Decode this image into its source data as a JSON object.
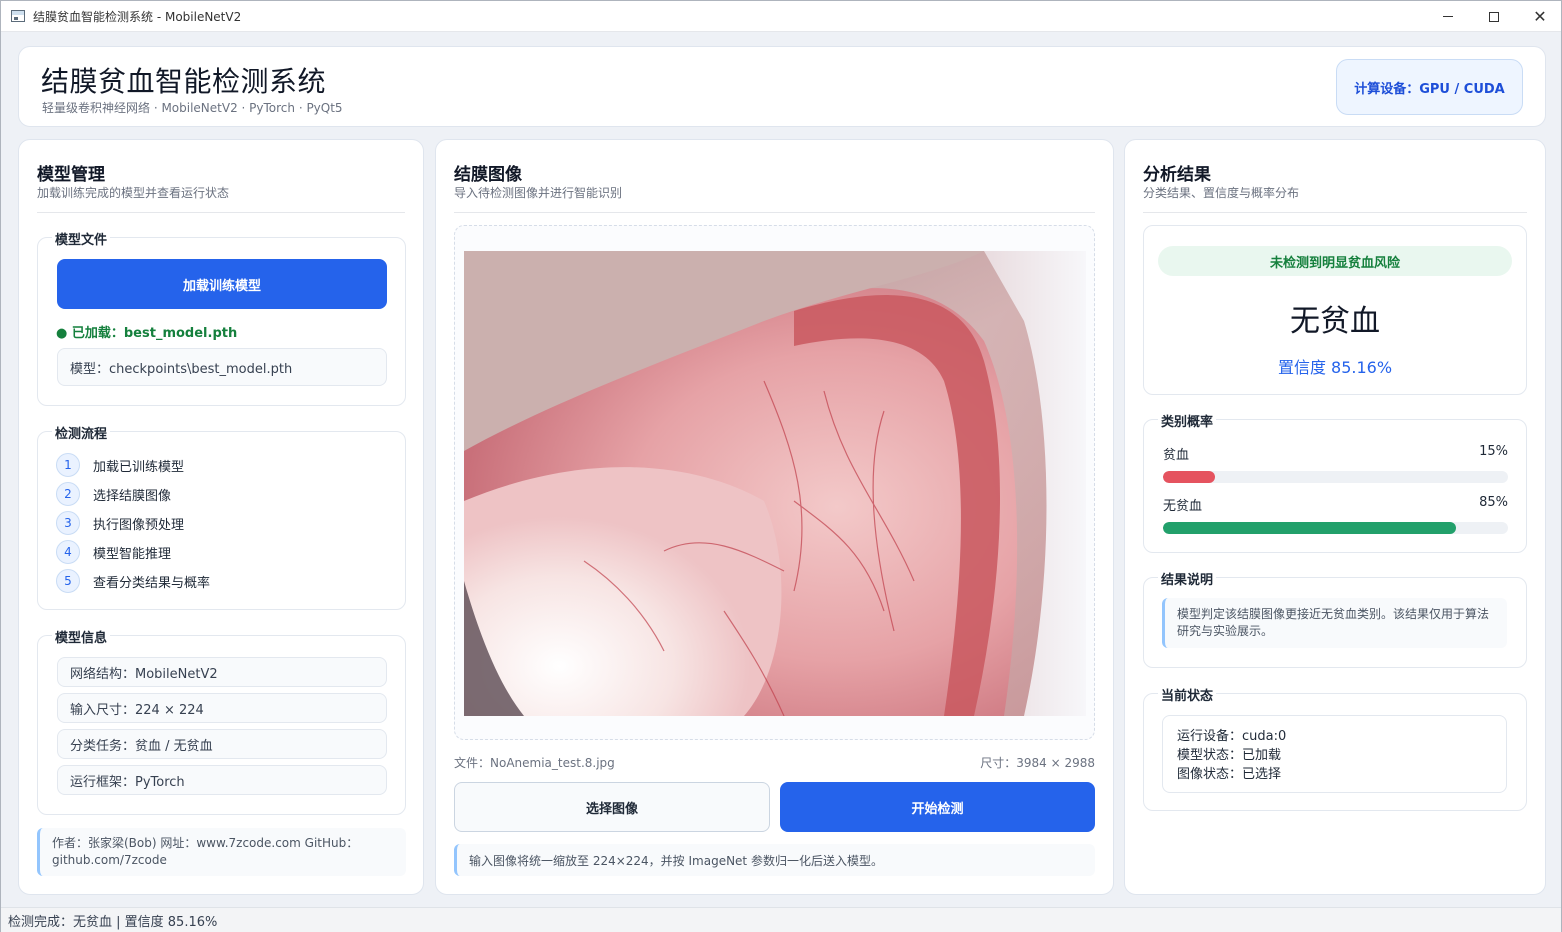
{
  "window": {
    "title": "结膜贫血智能检测系统 - MobileNetV2"
  },
  "header": {
    "title": "结膜贫血智能检测系统",
    "subtitle": "轻量级卷积神经网络 · MobileNetV2 · PyTorch · PyQt5",
    "device_badge": "计算设备：GPU / CUDA"
  },
  "left_panel": {
    "title": "模型管理",
    "subtitle": "加载训练完成的模型并查看运行状态",
    "model_file": {
      "label": "模型文件",
      "load_button": "加载训练模型",
      "loaded_status": "● 已加载：best_model.pth",
      "model_path": "模型：checkpoints\\best_model.pth"
    },
    "workflow": {
      "label": "检测流程",
      "steps": [
        {
          "num": "1",
          "text": "加载已训练模型"
        },
        {
          "num": "2",
          "text": "选择结膜图像"
        },
        {
          "num": "3",
          "text": "执行图像预处理"
        },
        {
          "num": "4",
          "text": "模型智能推理"
        },
        {
          "num": "5",
          "text": "查看分类结果与概率"
        }
      ]
    },
    "model_info": {
      "label": "模型信息",
      "items": [
        "网络结构：MobileNetV2",
        "输入尺寸：224 × 224",
        "分类任务：贫血 / 无贫血",
        "运行框架：PyTorch"
      ]
    },
    "author_note": "作者：张家梁(Bob)  网址：www.7zcode.com GitHub：github.com/7zcode"
  },
  "mid_panel": {
    "title": "结膜图像",
    "subtitle": "导入待检测图像并进行智能识别",
    "file_label": "文件：NoAnemia_test.8.jpg",
    "size_label": "尺寸：3984 × 2988",
    "select_button": "选择图像",
    "detect_button": "开始检测",
    "hint": "输入图像将统一缩放至 224×224，并按 ImageNet 参数归一化后送入模型。"
  },
  "right_panel": {
    "title": "分析结果",
    "subtitle": "分类结果、置信度与概率分布",
    "risk_banner": "未检测到明显贫血风险",
    "result_label": "无贫血",
    "confidence": "置信度   85.16%",
    "probabilities": {
      "label": "类别概率",
      "items": [
        {
          "name": "贫血",
          "value_text": "15%",
          "value": 0.15,
          "color": "#e5535f"
        },
        {
          "name": "无贫血",
          "value_text": "85%",
          "value": 0.85,
          "color": "#22a06b"
        }
      ]
    },
    "explanation": {
      "label": "结果说明",
      "text": "模型判定该结膜图像更接近无贫血类别。该结果仅用于算法研究与实验展示。"
    },
    "current_state": {
      "label": "当前状态",
      "device": "运行设备：cuda:0",
      "model_state": "模型状态：已加载",
      "image_state": "图像状态：已选择"
    }
  },
  "statusbar": {
    "text": "检测完成：无贫血  |  置信度 85.16%"
  },
  "colors": {
    "primary": "#2563eb",
    "success": "#15803d",
    "danger_bar": "#e5535f",
    "success_bar": "#22a06b"
  }
}
